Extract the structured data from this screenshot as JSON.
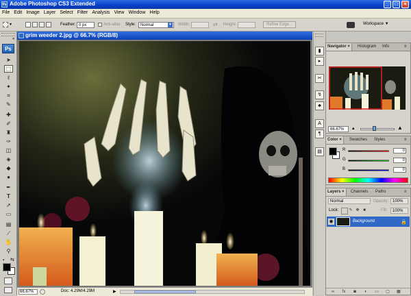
{
  "window": {
    "title": "Adobe Photoshop CS3 Extended",
    "ps_badge": "Ps",
    "min": "_",
    "max": "□",
    "close": "×"
  },
  "menu": [
    "File",
    "Edit",
    "Image",
    "Layer",
    "Select",
    "Filter",
    "Analysis",
    "View",
    "Window",
    "Help"
  ],
  "options": {
    "feather_label": "Feather:",
    "feather_value": "0 px",
    "antialias_label": "Anti-alias",
    "style_label": "Style:",
    "style_value": "Normal",
    "width_label": "Width:",
    "height_label": "Height:",
    "refine_label": "Refine Edge...",
    "workspace_label": "Workspace"
  },
  "tools": {
    "logo": "Ps"
  },
  "document": {
    "title": "grim weeder 2.jpg @ 66.7% (RGB/8)",
    "zoom": "66.67%",
    "doc_info": "Doc: 4.29M/4.29M"
  },
  "navigator": {
    "tabs": [
      "Navigator",
      "Histogram",
      "Info"
    ],
    "zoom": "66.67%"
  },
  "color": {
    "tabs": [
      "Color",
      "Swatches",
      "Styles"
    ],
    "channels": [
      {
        "label": "R",
        "value": "0"
      },
      {
        "label": "G",
        "value": "0"
      },
      {
        "label": "B",
        "value": "0"
      }
    ]
  },
  "layers": {
    "tabs": [
      "Layers",
      "Channels",
      "Paths"
    ],
    "blend": "Normal",
    "opacity_label": "Opacity:",
    "opacity": "100%",
    "lock_label": "Lock:",
    "fill_label": "Fill:",
    "fill": "100%",
    "layer_name": "Background"
  },
  "colors": {
    "titlebar": "#0a3fc8",
    "selected_layer": "#3169c6",
    "ps_blue": "#2a6db6"
  }
}
